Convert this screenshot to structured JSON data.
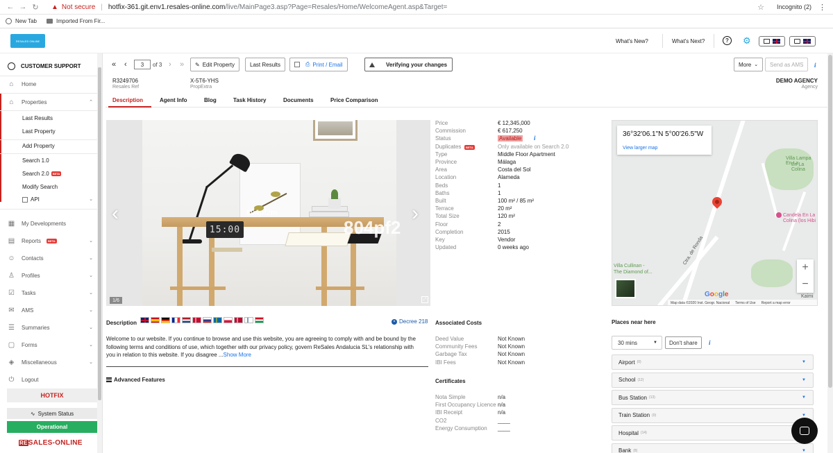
{
  "browser": {
    "not_secure": "Not secure",
    "url_host": "hotfix-361.git.env1.resales-online.com",
    "url_path": "/live/MainPage3.asp?Page=Resales/Home/WelcomeAgent.asp&Target=",
    "incognito": "Incognito (2)",
    "bookmarks": [
      "New Tab",
      "Imported From Fir..."
    ]
  },
  "header": {
    "whats_new": "What's New?",
    "whats_next": "What's Next?",
    "logo_text": "RESALES ONLINE"
  },
  "sidebar": {
    "customer_support": "CUSTOMER SUPPORT",
    "home": "Home",
    "properties": "Properties",
    "properties_sub": [
      "Last Results",
      "Last Property",
      "Add Property",
      "Search 1.0",
      "Search 2.0",
      "Modify Search",
      "API"
    ],
    "items": [
      "My Developments",
      "Reports",
      "Contacts",
      "Profiles",
      "Tasks",
      "AMS",
      "Summaries",
      "Forms",
      "Miscellaneous",
      "Logout"
    ],
    "beta": "BETA",
    "hotfix": "HOTFIX",
    "system_status": "System Status",
    "operational": "Operational",
    "brand_re": "RE",
    "brand_rest": "SALES-ONLINE"
  },
  "toolbar": {
    "page": "3",
    "of": "of 3",
    "edit_property": "Edit Property",
    "last_results": "Last Results",
    "print_email": "Print / Email",
    "verifying": "Verifying your changes",
    "more": "More",
    "send_ams": "Send as AMS"
  },
  "refs": {
    "ref_value": "R3249706",
    "ref_label": "Resales Ref",
    "propextra_value": "X-5T6-YHS",
    "propextra_label": "PropExtra",
    "agency_value": "DEMO AGENCY",
    "agency_label": "Agency"
  },
  "tabs": [
    "Description",
    "Agent Info",
    "Blog",
    "Task History",
    "Documents",
    "Price Comparison"
  ],
  "gallery": {
    "counter": "1/6",
    "watermark_small": "804pf2m",
    "watermark_large": "804pf2",
    "clock": "15:00"
  },
  "details": [
    {
      "label": "Price",
      "value": "€ 12,345,000"
    },
    {
      "label": "Commission",
      "value": "€ 617,250"
    },
    {
      "label": "Status",
      "value": "Available"
    },
    {
      "label": "Duplicates",
      "value": "Only available on Search 2.0"
    },
    {
      "label": "Type",
      "value": "Middle Floor Apartment"
    },
    {
      "label": "Province",
      "value": "Málaga"
    },
    {
      "label": "Area",
      "value": "Costa del Sol"
    },
    {
      "label": "Location",
      "value": "Alameda"
    },
    {
      "label": "Beds",
      "value": "1"
    },
    {
      "label": "Baths",
      "value": "1"
    },
    {
      "label": "Built",
      "value": "100 m² / 85 m²"
    },
    {
      "label": "Terrace",
      "value": "20 m²"
    },
    {
      "label": "Total Size",
      "value": "120 m²"
    },
    {
      "label": "Floor",
      "value": "2"
    },
    {
      "label": "Completion",
      "value": "2015"
    },
    {
      "label": "Key",
      "value": "Vendor"
    },
    {
      "label": "Updated",
      "value": "0 weeks ago"
    }
  ],
  "map": {
    "coords": "36°32'06.1\"N 5°00'26.5\"W",
    "larger": "View larger map",
    "villa_lampa": "Villa Lampa En La",
    "villa_lampa2": "En La Colina",
    "candela": "Candela En La",
    "candela2": "Colina (los Hibi",
    "villa_cullinan": "Villa Cullinan -",
    "villa_cullinan2": "The Diamond of...",
    "road": "Ctra. de Ronda",
    "kaimi": "Kaimi",
    "google": "Google",
    "map_data": "Map data ©2020 Inst. Geogr. Nacional",
    "terms": "Terms of Use",
    "report": "Report a map error"
  },
  "description": {
    "title": "Description",
    "decree": "Decree 218",
    "text": "Welcome to our website. If you continue to browse and use this website, you are agreeing to comply with and be bound by the following terms and conditions of use, which together with our privacy policy, govern ReSales Andalucia SL's relationship with you in relation to this website. If you disagree ...",
    "show_more": "Show More",
    "advanced": "Advanced Features"
  },
  "costs": {
    "title": "Associated Costs",
    "rows": [
      {
        "label": "Deed Value",
        "value": "Not Known"
      },
      {
        "label": "Community Fees",
        "value": "Not Known"
      },
      {
        "label": "Garbage Tax",
        "value": "Not Known"
      },
      {
        "label": "IBI Fees",
        "value": "Not Known"
      }
    ]
  },
  "certificates": {
    "title": "Certificates",
    "rows": [
      {
        "label": "Nota Simple",
        "value": "n/a"
      },
      {
        "label": "First Occupancy Licence",
        "value": "n/a"
      },
      {
        "label": "IBI Receipt",
        "value": "n/a"
      },
      {
        "label": "CO2",
        "value": "____"
      },
      {
        "label": "Energy Consumption",
        "value": "____"
      }
    ]
  },
  "places": {
    "title": "Places near here",
    "mins": "30 mins",
    "dont_share": "Don't share",
    "list": [
      {
        "name": "Airport",
        "count": "(0)"
      },
      {
        "name": "School",
        "count": "(12)"
      },
      {
        "name": "Bus Station",
        "count": "(13)"
      },
      {
        "name": "Train Station",
        "count": "(0)"
      },
      {
        "name": "Hospital",
        "count": "(14)"
      },
      {
        "name": "Bank",
        "count": "(8)"
      }
    ]
  }
}
